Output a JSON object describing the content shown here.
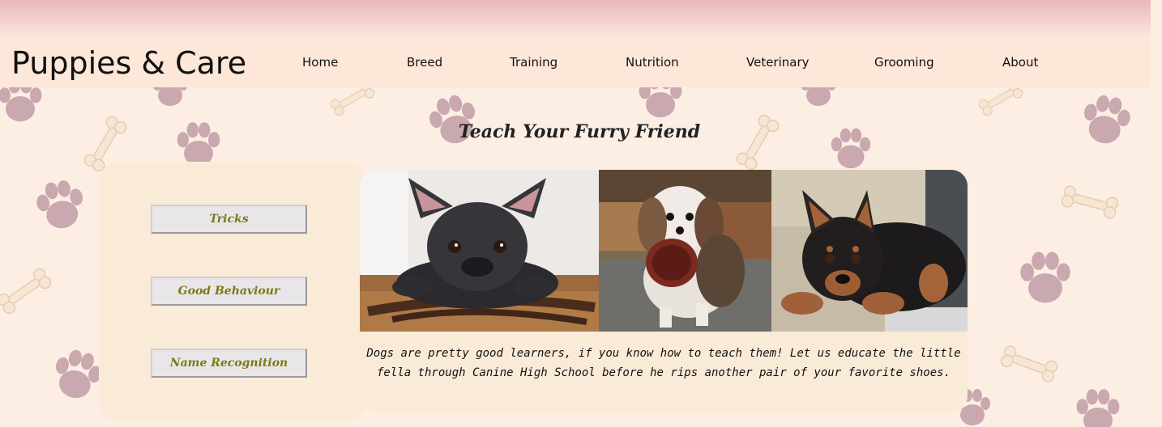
{
  "site": {
    "title": "Puppies & Care"
  },
  "nav": {
    "items": [
      {
        "label": "Home"
      },
      {
        "label": "Breed"
      },
      {
        "label": "Training"
      },
      {
        "label": "Nutrition"
      },
      {
        "label": "Veterinary"
      },
      {
        "label": "Grooming"
      },
      {
        "label": "About"
      }
    ]
  },
  "page": {
    "heading": "Teach Your Furry Friend"
  },
  "sidebar": {
    "buttons": [
      {
        "label": "Tricks"
      },
      {
        "label": "Good Behaviour"
      },
      {
        "label": "Name Recognition"
      }
    ]
  },
  "photos": [
    {
      "name": "french-bulldog-photo",
      "icon": "dog-photo"
    },
    {
      "name": "shih-tzu-puppy-photo",
      "icon": "dog-photo"
    },
    {
      "name": "rottweiler-puppy-photo",
      "icon": "dog-photo"
    }
  ],
  "main": {
    "description": "Dogs are pretty good learners, if you know how to teach them! Let us educate the little fella through Canine High School before he rips another pair of your favorite shoes."
  },
  "colors": {
    "background": "#fdeee3",
    "paw": "#c9a8b0",
    "bone": "#f8e6d2",
    "panel": "#faebd9",
    "button_text": "#7a7a12"
  }
}
